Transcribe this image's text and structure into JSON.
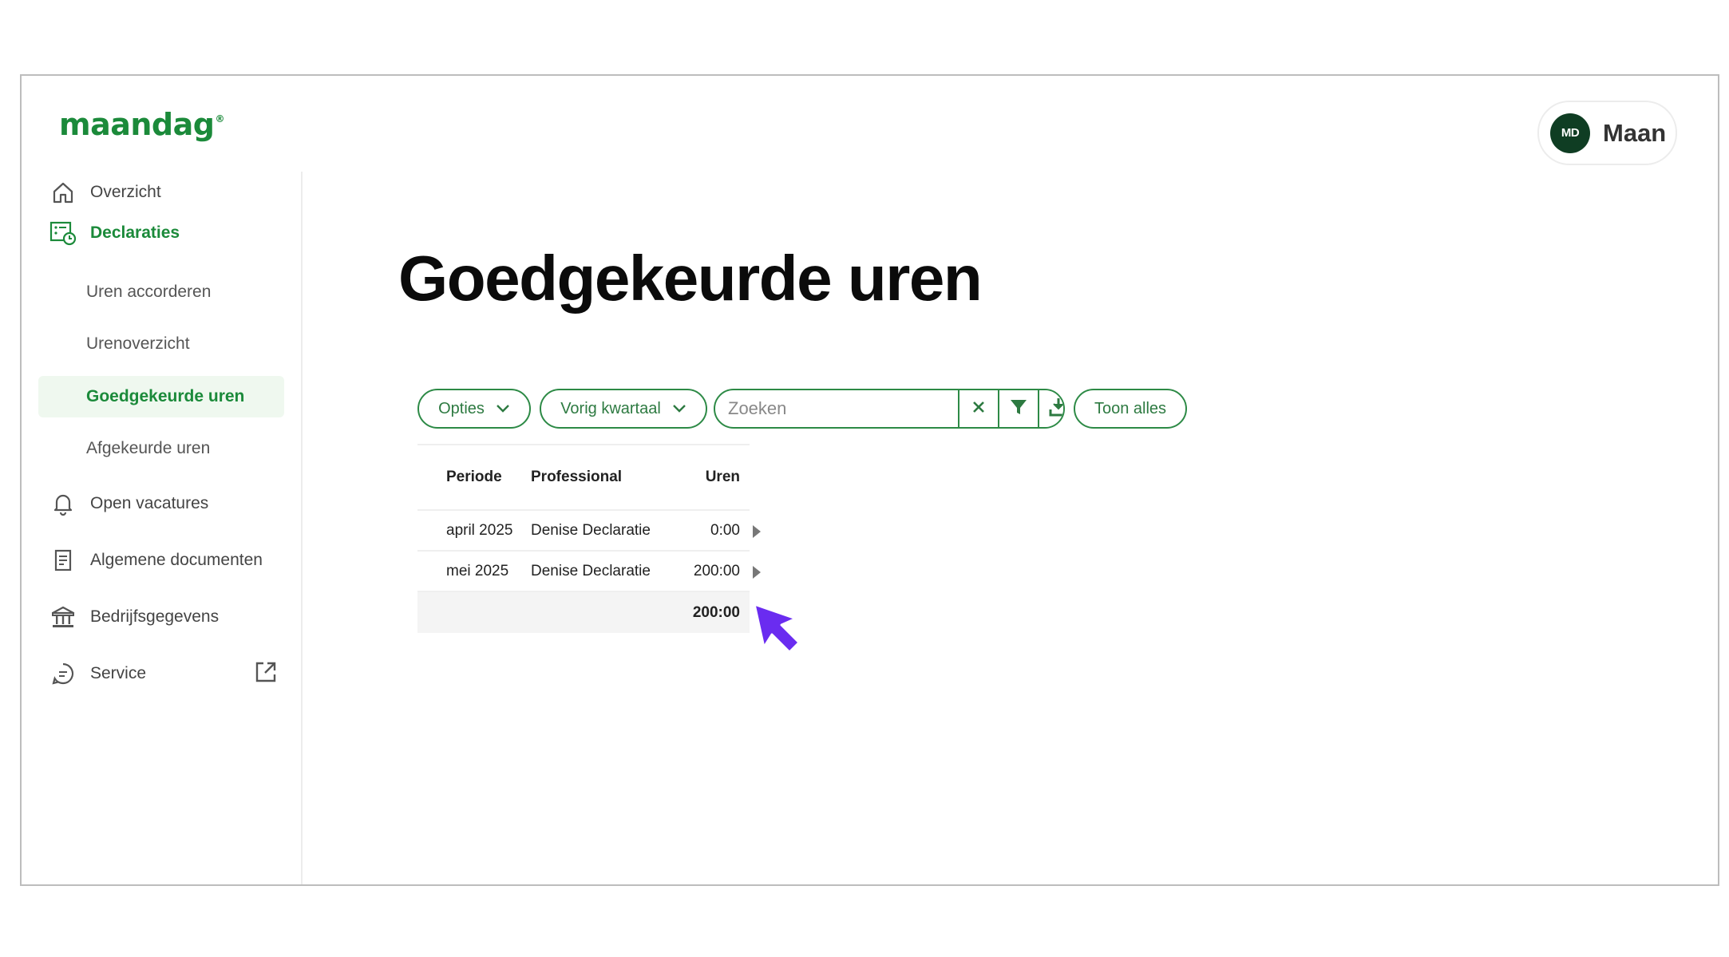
{
  "brand": {
    "logo_text": "maandag",
    "logo_mark": "®",
    "accent": "#1b8a3a"
  },
  "user": {
    "initials": "MD",
    "name": "Maan"
  },
  "sidebar": {
    "items": [
      {
        "label": "Overzicht",
        "icon": "home-icon"
      },
      {
        "label": "Declaraties",
        "icon": "timesheet-icon",
        "active": true
      },
      {
        "label": "Open vacatures",
        "icon": "bell-icon"
      },
      {
        "label": "Algemene documenten",
        "icon": "document-icon"
      },
      {
        "label": "Bedrijfsgegevens",
        "icon": "building-icon"
      },
      {
        "label": "Service",
        "icon": "chat-icon",
        "external": true
      }
    ],
    "subitems": [
      {
        "label": "Uren accorderen"
      },
      {
        "label": "Urenoverzicht"
      },
      {
        "label": "Goedgekeurde uren",
        "active": true
      },
      {
        "label": "Afgekeurde uren"
      }
    ]
  },
  "page": {
    "title": "Goedgekeurde uren"
  },
  "toolbar": {
    "options_label": "Opties",
    "period_label": "Vorig kwartaal",
    "search_placeholder": "Zoeken",
    "show_all_label": "Toon alles"
  },
  "table": {
    "columns": [
      "Periode",
      "Professional",
      "Uren"
    ],
    "rows": [
      {
        "periode": "april 2025",
        "professional": "Denise Declaratie",
        "uren": "0:00"
      },
      {
        "periode": "mei 2025",
        "professional": "Denise Declaratie",
        "uren": "200:00"
      }
    ],
    "total": "200:00"
  },
  "colors": {
    "green": "#2d8a46",
    "cursor": "#6a2cf0",
    "avatar_bg": "#0f3d23"
  }
}
